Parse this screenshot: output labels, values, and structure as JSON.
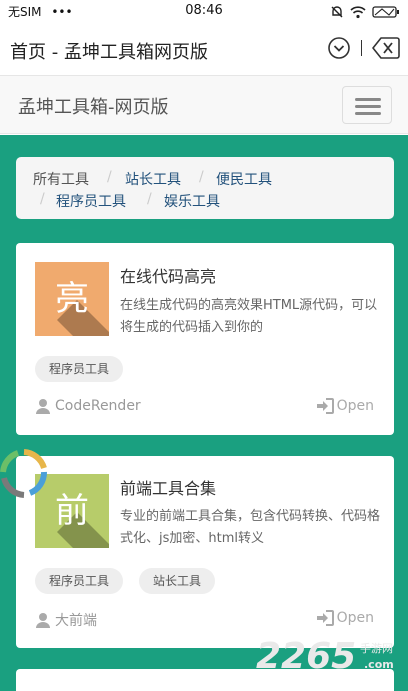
{
  "status_bar": {
    "carrier": "无SIM",
    "dots": "•••",
    "time": "08:46"
  },
  "browser": {
    "title": "首页 - 孟坤工具箱网页版"
  },
  "site": {
    "brand": "孟坤工具箱-网页版"
  },
  "breadcrumb": {
    "items": [
      {
        "label": "所有工具"
      },
      {
        "label": "站长工具"
      },
      {
        "label": "便民工具"
      },
      {
        "label": "程序员工具"
      },
      {
        "label": "娱乐工具"
      }
    ],
    "separator": "/"
  },
  "cards": [
    {
      "thumb_char": "亮",
      "thumb_color": "#f0aa6e",
      "title": "在线代码高亮",
      "desc": "在线生成代码的高亮效果HTML源代码，可以将生成的代码插入到你的",
      "tags": [
        "程序员工具"
      ],
      "author": "CodeRender",
      "open_label": "Open"
    },
    {
      "thumb_char": "前",
      "thumb_color": "#b7cc6a",
      "title": "前端工具合集",
      "desc": "专业的前端工具合集，包含代码转换、代码格式化、js加密、html转义",
      "tags": [
        "程序员工具",
        "站长工具"
      ],
      "author": "大前端",
      "open_label": "Open"
    }
  ],
  "watermark": {
    "number": "2265",
    "sub": "手游网",
    "domain": ".com"
  },
  "colors": {
    "page_green": "#1aa080",
    "link": "#23527c"
  }
}
